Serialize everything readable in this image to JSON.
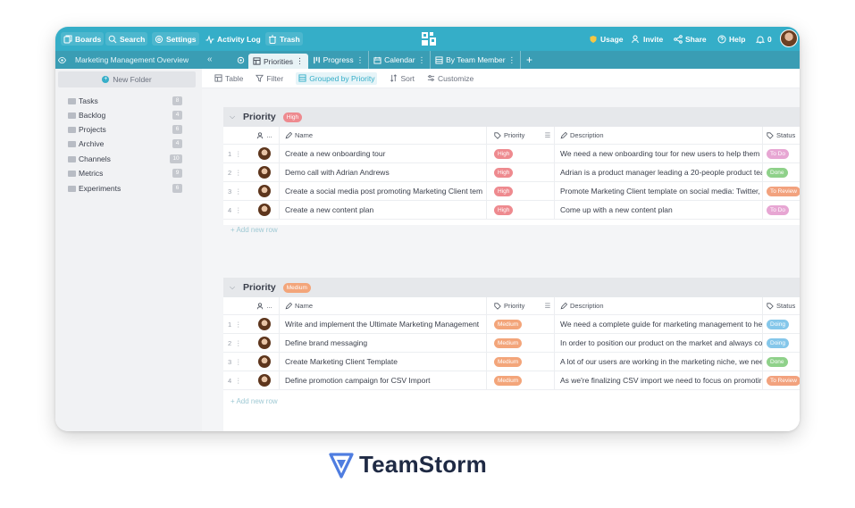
{
  "colors": {
    "topbar": "#35aec8",
    "subbar": "#3a9db4",
    "high": "#ee8a8f",
    "medium": "#f3a57a",
    "to_do": "#e7a6d3",
    "done": "#8fd18a",
    "to_review": "#f2a27e",
    "doing": "#85c7ea",
    "usage": "#f6c744"
  },
  "topbar": {
    "boards": "Boards",
    "search": "Search",
    "settings": "Settings",
    "activity_log": "Activity Log",
    "trash": "Trash",
    "usage": "Usage",
    "invite": "Invite",
    "share": "Share",
    "help": "Help",
    "notifications": "0"
  },
  "subbar": {
    "workspace_title": "Marketing Management Overview",
    "collapse": "«",
    "tabs": [
      {
        "label": "Priorities",
        "icon": "table-icon"
      },
      {
        "label": "Progress",
        "icon": "kanban-icon"
      },
      {
        "label": "Calendar",
        "icon": "calendar-icon"
      },
      {
        "label": "By Team Member",
        "icon": "list-icon"
      }
    ],
    "tab_menu": "⋮",
    "add_tab": "+"
  },
  "sidebar": {
    "new_folder": "New Folder",
    "folders": [
      {
        "label": "Tasks",
        "count": "8"
      },
      {
        "label": "Backlog",
        "count": "4"
      },
      {
        "label": "Projects",
        "count": "6"
      },
      {
        "label": "Archive",
        "count": "4"
      },
      {
        "label": "Channels",
        "count": "10"
      },
      {
        "label": "Metrics",
        "count": "9"
      },
      {
        "label": "Experiments",
        "count": "6"
      }
    ]
  },
  "toolbar": {
    "table": "Table",
    "filter": "Filter",
    "grouped": "Grouped by Priority",
    "sort": "Sort",
    "customize": "Customize"
  },
  "columns": {
    "assignee": "...",
    "name": "Name",
    "priority": "Priority",
    "description": "Description",
    "status": "Status"
  },
  "groups": [
    {
      "title": "Priority",
      "badge": "High",
      "add_row": "+ Add new row",
      "rows": [
        {
          "num": "1",
          "name": "Create a new onboarding tour",
          "priority": "High",
          "description": "We need a new onboarding tour for new users to help them u",
          "status": "To Do"
        },
        {
          "num": "2",
          "name": "Demo call with Adrian Andrews",
          "priority": "High",
          "description": "Adrian is a product manager leading a 20-people product tea",
          "status": "Done"
        },
        {
          "num": "3",
          "name": "Create a social media post promoting Marketing Client tem",
          "priority": "High",
          "description": "Promote Marketing Client template on social media: Twitter,",
          "status": "To Review"
        },
        {
          "num": "4",
          "name": "Create a new content plan",
          "priority": "High",
          "description": "Come up with a new content plan",
          "status": "To Do"
        }
      ]
    },
    {
      "title": "Priority",
      "badge": "Medium",
      "add_row": "+ Add new row",
      "rows": [
        {
          "num": "1",
          "name": "Write and implement the Ultimate Marketing Management",
          "priority": "Medium",
          "description": "We need a complete guide for marketing management to he",
          "status": "Doing"
        },
        {
          "num": "2",
          "name": "Define brand messaging",
          "priority": "Medium",
          "description": "In order to position our product on the market and always co",
          "status": "Doing"
        },
        {
          "num": "3",
          "name": "Create Marketing Client Template",
          "priority": "Medium",
          "description": "A lot of our users are working in the marketing niche, we nee",
          "status": "Done"
        },
        {
          "num": "4",
          "name": "Define promotion campaign for CSV Import",
          "priority": "Medium",
          "description": "As we're finalizing CSV import we need to focus on promotir",
          "status": "To Review"
        }
      ]
    }
  ],
  "brand": {
    "name": "TeamStorm"
  }
}
